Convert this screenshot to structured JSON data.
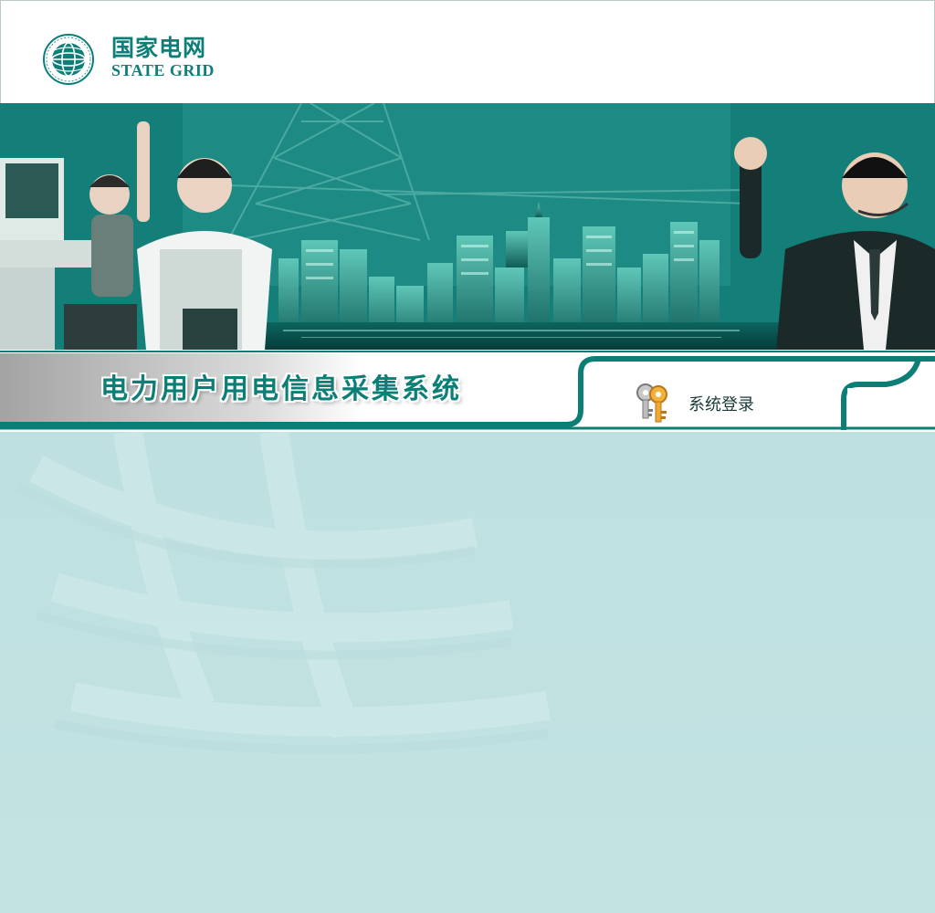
{
  "header": {
    "brand_cn": "国家电网",
    "brand_en": "STATE GRID",
    "logo_icon": "state-grid-globe-logo"
  },
  "banner": {
    "image": "banner-city-skyline-with-people"
  },
  "titlebar": {
    "system_title": "电力用户用电信息采集系统",
    "login_label": "系统登录",
    "login_icon": "keys-icon"
  },
  "colors": {
    "brand_teal": "#0e7e78",
    "banner_dark": "#0d6d68",
    "page_bg": "#c3e2e2",
    "title_bar_gray": "#a9a9a9"
  }
}
